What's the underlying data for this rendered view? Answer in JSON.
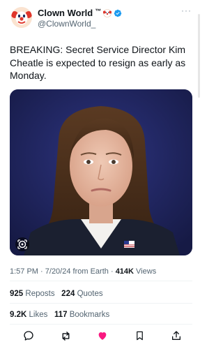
{
  "author": {
    "name": "Clown World",
    "tm": "™",
    "handle": "@ClownWorld_",
    "verified": true,
    "badge_color": "#1d9bf0"
  },
  "more_menu": "···",
  "tweet": {
    "text": "BREAKING: Secret Service Director Kim Cheatle is expected to resign as early as Monday."
  },
  "meta": {
    "time": "1:57 PM",
    "date": "7/20/24",
    "source": "from Earth",
    "views_count": "414K",
    "views_label": "Views"
  },
  "stats": {
    "reposts_count": "925",
    "reposts_label": "Reposts",
    "quotes_count": "224",
    "quotes_label": "Quotes",
    "likes_count": "9.2K",
    "likes_label": "Likes",
    "bookmarks_count": "117",
    "bookmarks_label": "Bookmarks"
  },
  "actions": {
    "reply_icon": "reply-icon",
    "repost_icon": "repost-icon",
    "like_icon": "like-icon-filled",
    "bookmark_icon": "bookmark-icon",
    "share_icon": "share-icon",
    "like_color": "#f91880"
  }
}
